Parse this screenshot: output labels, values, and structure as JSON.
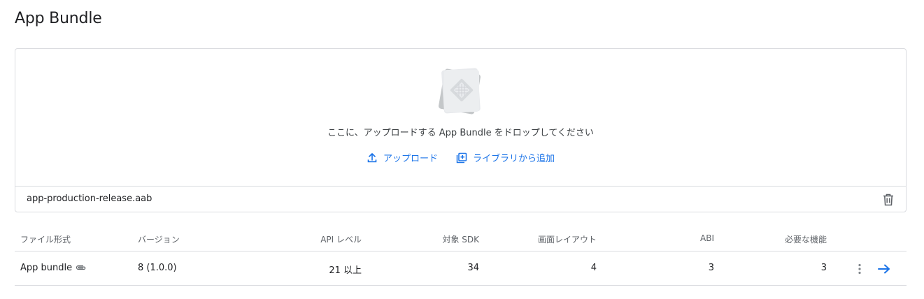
{
  "page": {
    "title": "App Bundle"
  },
  "dropzone": {
    "illustration_icon": "app-bundle-file-icon",
    "message": "ここに、アップロードする App Bundle をドロップしてください",
    "upload_label": "アップロード",
    "upload_icon": "upload-icon",
    "library_label": "ライブラリから追加",
    "library_icon": "add-to-library-icon"
  },
  "uploaded_file": {
    "name": "app-production-release.aab",
    "delete_icon": "trash-icon"
  },
  "table": {
    "headers": {
      "format": "ファイル形式",
      "version": "バージョン",
      "api_level": "API レベル",
      "target_sdk": "対象 SDK",
      "screen_layout": "画面レイアウト",
      "abi": "ABI",
      "required_features": "必要な機能"
    },
    "rows": [
      {
        "format": "App bundle",
        "format_icon": "paperclip-icon",
        "version": "8 (1.0.0)",
        "api_level": "21 以上",
        "target_sdk": "34",
        "screen_layout": "4",
        "abi": "3",
        "required_features": "3",
        "more_icon": "more-vert-icon",
        "open_icon": "arrow-right-icon"
      }
    ]
  },
  "colors": {
    "accent": "#1a73e8",
    "border": "#dadce0",
    "text_primary": "#202124",
    "text_secondary": "#5f6368"
  }
}
